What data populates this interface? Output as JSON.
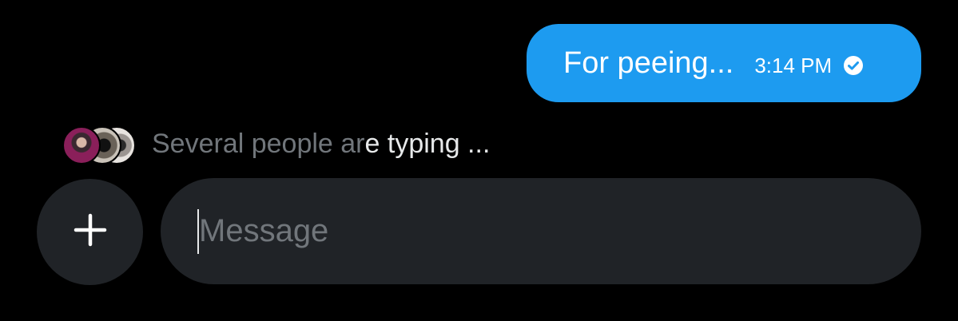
{
  "message": {
    "text": "For peeing...",
    "time": "3:14 PM",
    "status_icon": "check-circle-icon",
    "bubble_color": "#1d9bf0"
  },
  "typing_indicator": {
    "prefix": "Several people ar",
    "suffix": "e typing ..."
  },
  "composer": {
    "add_icon": "plus-icon",
    "placeholder": "Message",
    "value": ""
  }
}
